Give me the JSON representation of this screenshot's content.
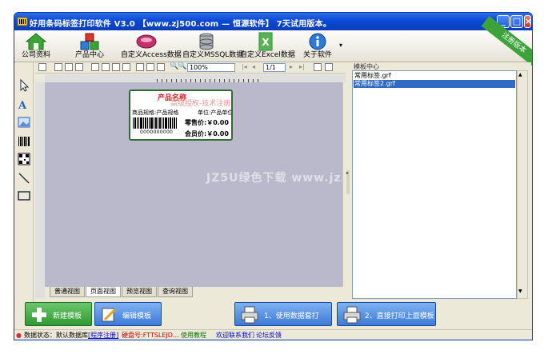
{
  "window": {
    "title": "好用条码标签打印软件 V3.0  【www.zj500.com — 恒源软件】    7天试用版本。"
  },
  "toolbar": {
    "items": [
      {
        "label": "公司资料",
        "icon": "house-icon"
      },
      {
        "label": "产品中心",
        "icon": "boxes-icon"
      },
      {
        "label": "自定义Access数据",
        "icon": "access-db-icon"
      },
      {
        "label": "自定义MSSQL数据",
        "icon": "database-icon"
      },
      {
        "label": "自定义Excel数据",
        "icon": "excel-icon"
      },
      {
        "label": "关于软件",
        "icon": "info-icon"
      }
    ],
    "ribbon": "注册版本"
  },
  "design_toolbar": {
    "zoom": "100%",
    "page": "1/1"
  },
  "label": {
    "title": "产品名称",
    "watermark": "高级授权-技术注册",
    "spec": "商品规格:产品规格",
    "unit": "单位:产品单位",
    "barcode_text": "0000000000",
    "retail_price": "零售价:￥0.00",
    "member_price": "会员价:￥0.00"
  },
  "view_tabs": [
    "普通视图",
    "页面视图",
    "预览视图",
    "查询视图"
  ],
  "template_panel": {
    "title": "模板中心",
    "items": [
      "常用标签.grf",
      "常用标签2.grf"
    ],
    "selected_index": 1
  },
  "bottom_buttons": {
    "new_template": "新建模板",
    "edit_template": "编辑模板",
    "use_data_print": "1、使用数据套打",
    "direct_print": "2、直接打印上面模板"
  },
  "status": {
    "data_state": "数据状态：默认数据库",
    "register": "[程序注册]",
    "disk": "硬盘号:FTTSLEJD...",
    "version_label": "使用教程",
    "contact": "欢迎联系我们",
    "forum": "论坛反馈"
  },
  "watermark_overlay": "JZ5U绿色下载  www.jz5u.com",
  "colors": {
    "titlebar": "#0a49d8",
    "accent_green": "#3da23a",
    "selection": "#316ac5",
    "canvas": "#b9b9cb"
  }
}
